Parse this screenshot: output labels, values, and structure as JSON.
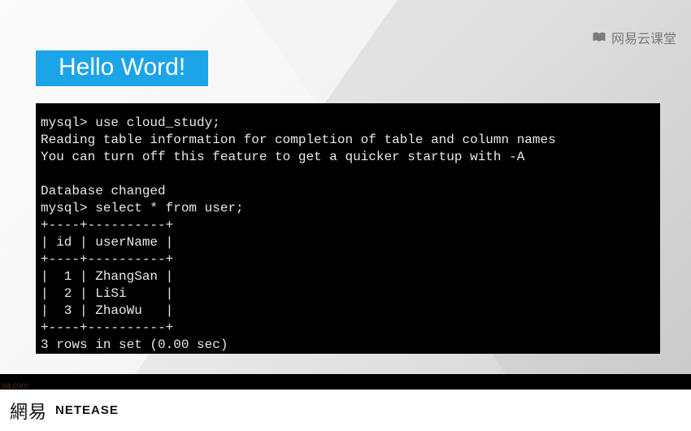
{
  "watermark_top_right": {
    "icon": "book-icon",
    "text": "网易云课堂"
  },
  "title": "Hello Word!",
  "terminal": {
    "prompt1": "mysql> use cloud_study;",
    "msg1": "Reading table information for completion of table and column names",
    "msg2": "You can turn off this feature to get a quicker startup with -A",
    "blank1": "",
    "changed": "Database changed",
    "prompt2": "mysql> select * from user;",
    "hr1": "+----+----------+",
    "header": "| id | userName |",
    "hr2": "+----+----------+",
    "row1": "|  1 | ZhangSan |",
    "row2": "|  2 | LiSi     |",
    "row3": "|  3 | ZhaoWu   |",
    "hr3": "+----+----------+",
    "summary": "3 rows in set (0.00 sec)"
  },
  "chart_data": {
    "type": "table",
    "title": "user",
    "columns": [
      "id",
      "userName"
    ],
    "rows": [
      [
        1,
        "ZhangSan"
      ],
      [
        2,
        "LiSi"
      ],
      [
        3,
        "ZhaoWu"
      ]
    ],
    "row_count": 3,
    "elapsed_sec": 0.0,
    "database": "cloud_study",
    "query": "select * from user;"
  },
  "footer": {
    "brand_cn": "網易",
    "brand_en": "NETEASE"
  },
  "va_wm": "va.com"
}
